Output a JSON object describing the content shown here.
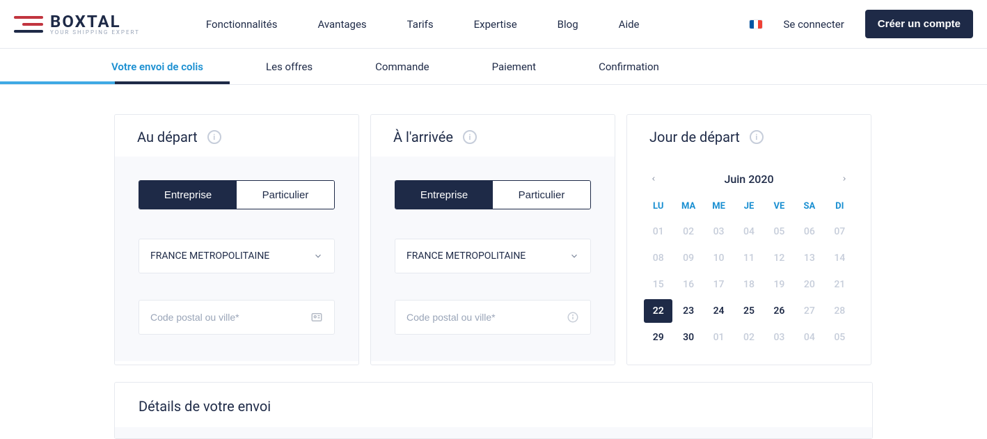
{
  "brand": {
    "name": "BOXTAL",
    "tagline": "YOUR SHIPPING EXPERT"
  },
  "nav": {
    "items": [
      "Fonctionnalités",
      "Avantages",
      "Tarifs",
      "Expertise",
      "Blog",
      "Aide"
    ],
    "login": "Se connecter",
    "cta": "Créer un compte"
  },
  "steps": {
    "items": [
      "Votre envoi de colis",
      "Les offres",
      "Commande",
      "Paiement",
      "Confirmation"
    ],
    "active_index": 0
  },
  "departure": {
    "title": "Au départ",
    "seg_business": "Entreprise",
    "seg_individual": "Particulier",
    "country": "FRANCE METROPOLITAINE",
    "postal_placeholder": "Code postal ou ville*"
  },
  "arrival": {
    "title": "À l'arrivée",
    "seg_business": "Entreprise",
    "seg_individual": "Particulier",
    "country": "FRANCE METROPOLITAINE",
    "postal_placeholder": "Code postal ou ville*"
  },
  "calendar": {
    "title": "Jour de départ",
    "month_label": "Juin 2020",
    "dow": [
      "LU",
      "MA",
      "ME",
      "JE",
      "VE",
      "SA",
      "DI"
    ],
    "weeks": [
      [
        {
          "n": "01",
          "d": true
        },
        {
          "n": "02",
          "d": true
        },
        {
          "n": "03",
          "d": true
        },
        {
          "n": "04",
          "d": true
        },
        {
          "n": "05",
          "d": true
        },
        {
          "n": "06",
          "d": true
        },
        {
          "n": "07",
          "d": true
        }
      ],
      [
        {
          "n": "08",
          "d": true
        },
        {
          "n": "09",
          "d": true
        },
        {
          "n": "10",
          "d": true
        },
        {
          "n": "11",
          "d": true
        },
        {
          "n": "12",
          "d": true
        },
        {
          "n": "13",
          "d": true
        },
        {
          "n": "14",
          "d": true
        }
      ],
      [
        {
          "n": "15",
          "d": true
        },
        {
          "n": "16",
          "d": true
        },
        {
          "n": "17",
          "d": true
        },
        {
          "n": "18",
          "d": true
        },
        {
          "n": "19",
          "d": true
        },
        {
          "n": "20",
          "d": true
        },
        {
          "n": "21",
          "d": true
        }
      ],
      [
        {
          "n": "22",
          "sel": true
        },
        {
          "n": "23"
        },
        {
          "n": "24"
        },
        {
          "n": "25"
        },
        {
          "n": "26"
        },
        {
          "n": "27",
          "d": true
        },
        {
          "n": "28",
          "d": true
        }
      ],
      [
        {
          "n": "29"
        },
        {
          "n": "30"
        },
        {
          "n": "01",
          "d": true
        },
        {
          "n": "02",
          "d": true
        },
        {
          "n": "03",
          "d": true
        },
        {
          "n": "04",
          "d": true
        },
        {
          "n": "05",
          "d": true
        }
      ]
    ]
  },
  "details": {
    "title": "Détails de votre envoi"
  }
}
